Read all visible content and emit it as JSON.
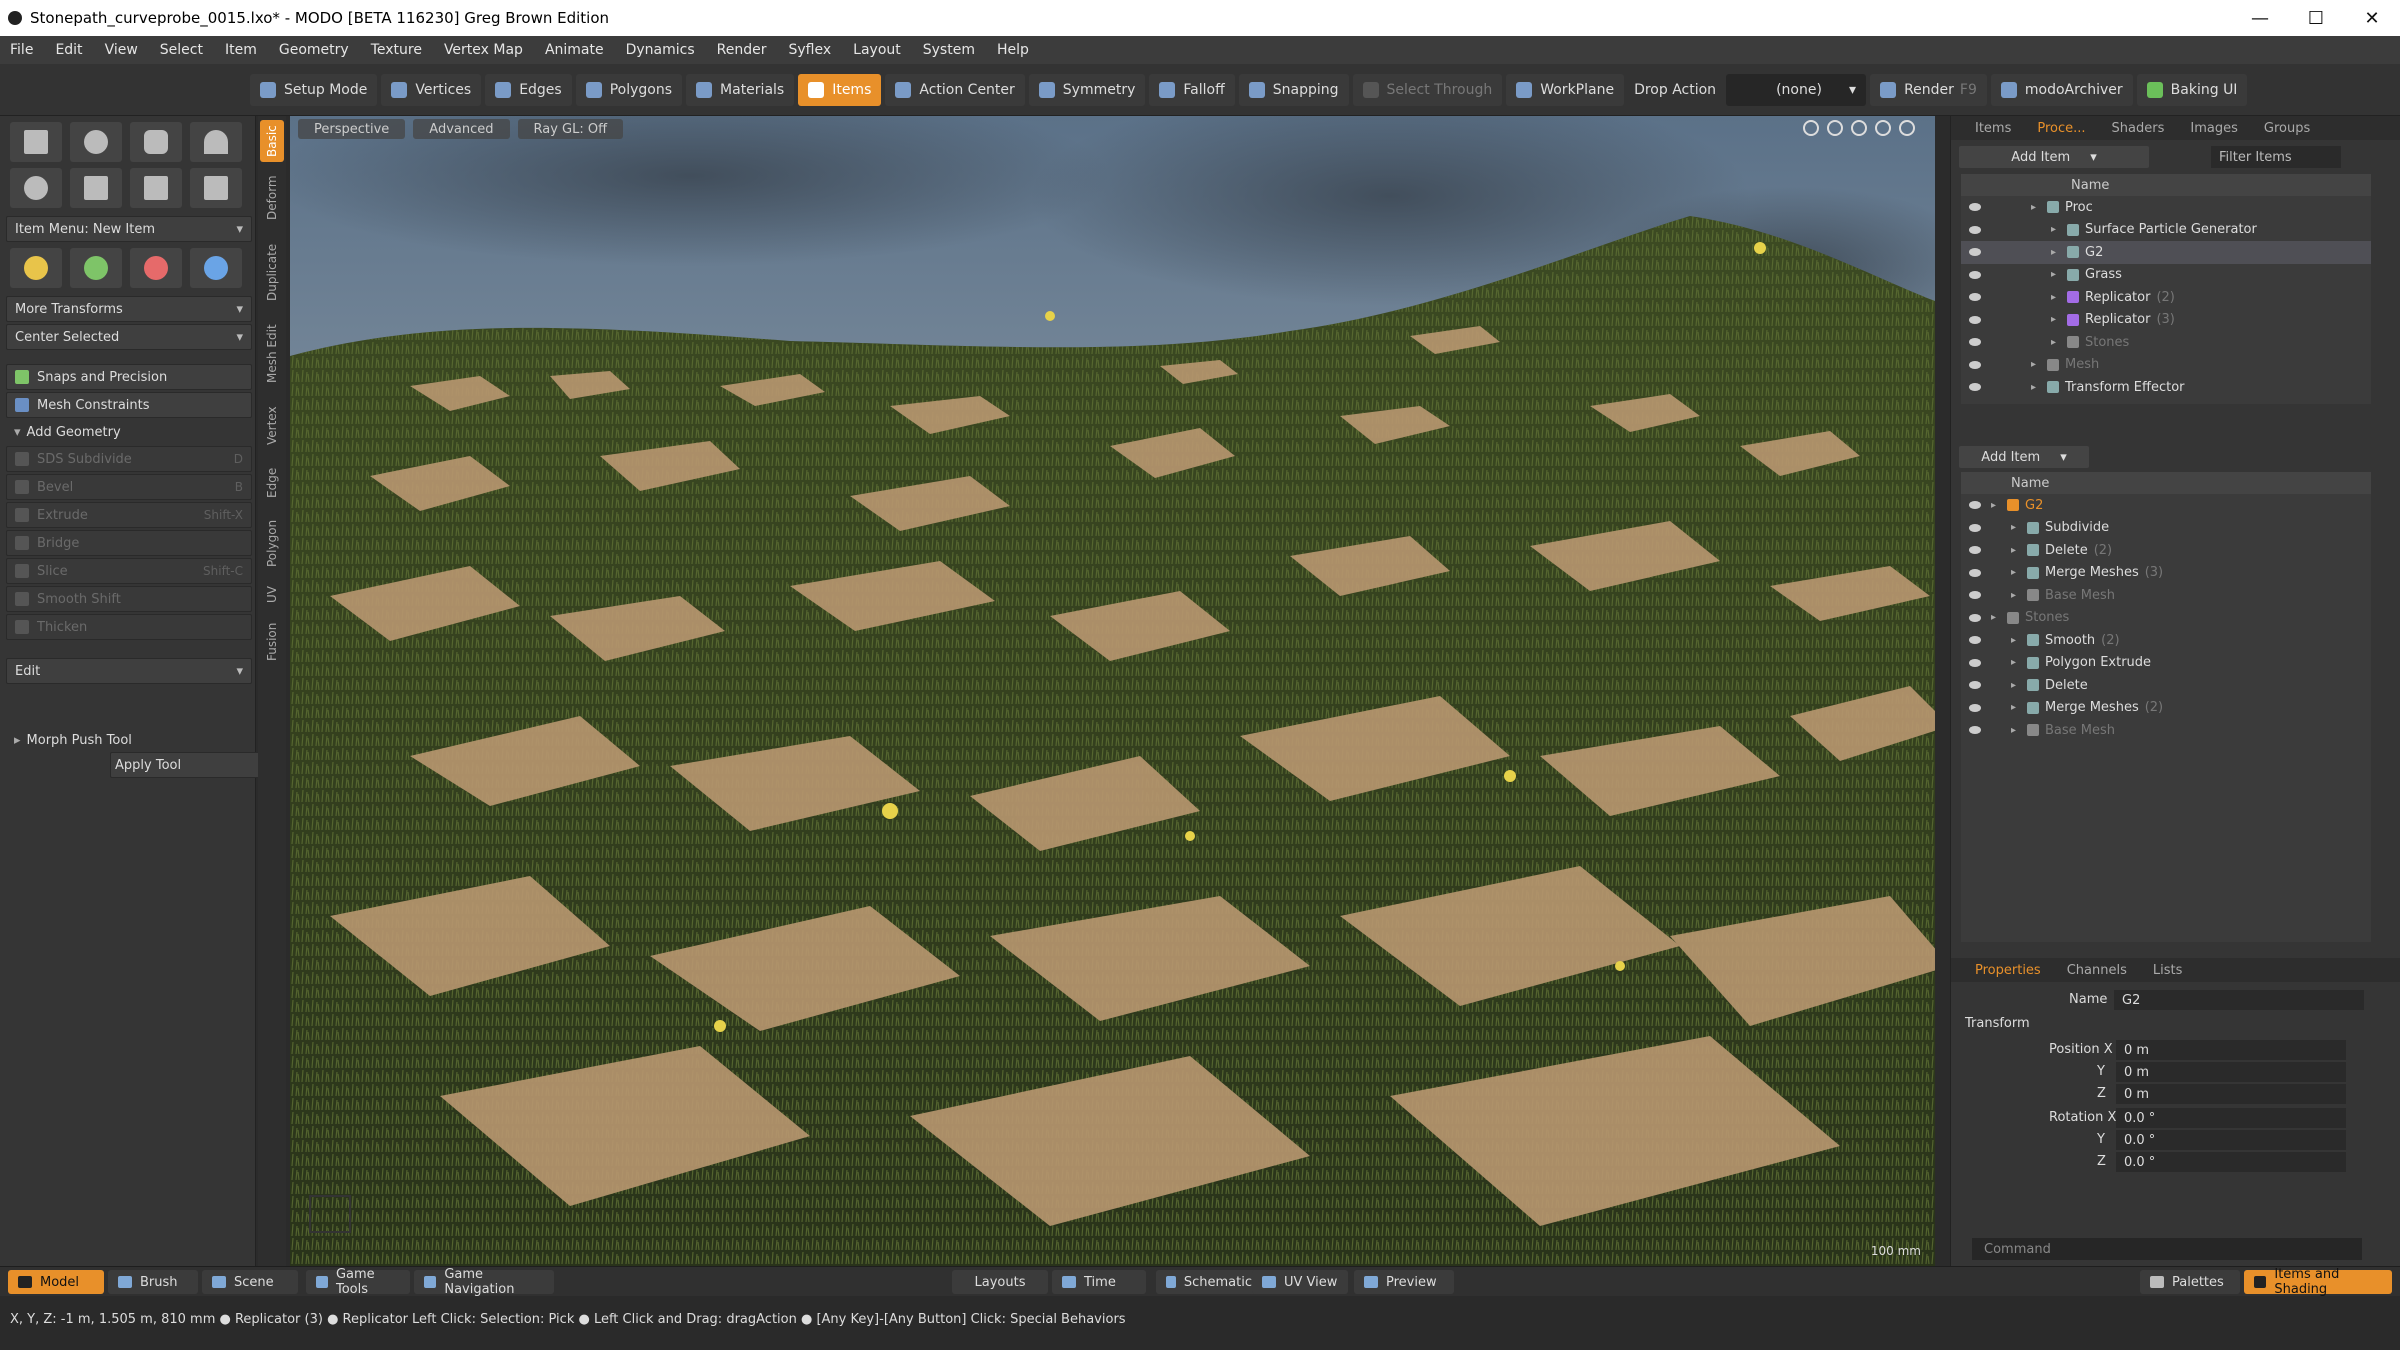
{
  "window": {
    "title": "Stonepath_curveprobe_0015.lxo* - MODO [BETA 116230] Greg Brown Edition",
    "controls": {
      "minimize": "—",
      "maximize": "☐",
      "close": "✕"
    }
  },
  "menu": [
    "File",
    "Edit",
    "View",
    "Select",
    "Item",
    "Geometry",
    "Texture",
    "Vertex Map",
    "Animate",
    "Dynamics",
    "Render",
    "Syflex",
    "Layout",
    "System",
    "Help"
  ],
  "toolbar": {
    "setup_mode": "Setup Mode",
    "vertices": "Vertices",
    "edges": "Edges",
    "polygons": "Polygons",
    "materials": "Materials",
    "items": "Items",
    "action_center": "Action Center",
    "symmetry": "Symmetry",
    "falloff": "Falloff",
    "snapping": "Snapping",
    "select_through": "Select Through",
    "workplane": "WorkPlane",
    "drop_action_label": "Drop Action",
    "drop_action_value": "(none)",
    "render": "Render",
    "render_key": "F9",
    "modoarchiver": "modoArchiver",
    "baking_ui": "Baking UI"
  },
  "left_panel": {
    "item_menu": "Item Menu: New Item",
    "more_transforms": "More Transforms",
    "center_selected": "Center Selected",
    "snaps_precision": "Snaps and Precision",
    "mesh_constraints": "Mesh Constraints",
    "add_geometry": "Add Geometry",
    "tools": [
      {
        "label": "SDS Subdivide",
        "shortcut": "D"
      },
      {
        "label": "Bevel",
        "shortcut": "B"
      },
      {
        "label": "Extrude",
        "shortcut": "Shift-X"
      },
      {
        "label": "Bridge",
        "shortcut": ""
      },
      {
        "label": "Slice",
        "shortcut": "Shift-C"
      },
      {
        "label": "Smooth Shift",
        "shortcut": ""
      },
      {
        "label": "Thicken",
        "shortcut": ""
      }
    ],
    "edit": "Edit",
    "morph_push_tool": "Morph Push Tool",
    "apply_tool": "Apply Tool",
    "vertical_tabs": [
      "Basic",
      "Deform",
      "Duplicate",
      "Mesh Edit",
      "Vertex",
      "Edge",
      "Polygon",
      "UV",
      "Fusion"
    ]
  },
  "viewport": {
    "tabs": [
      "Perspective",
      "Advanced",
      "Ray GL: Off"
    ],
    "info": "100 mm"
  },
  "right_panel": {
    "top_tabs": [
      "Items",
      "Proce...",
      "Shaders",
      "Images",
      "Groups"
    ],
    "add_item": "Add Item",
    "filter_items": "Filter Items",
    "name_header": "Name",
    "tree_top": [
      {
        "label": "Proc",
        "indent": 1,
        "type": "folder"
      },
      {
        "label": "Surface Particle Generator",
        "indent": 2,
        "type": "gen"
      },
      {
        "label": "G2",
        "indent": 2,
        "type": "mesh",
        "selected": true
      },
      {
        "label": "Grass",
        "indent": 2,
        "type": "mesh"
      },
      {
        "label": "Replicator",
        "count": "(2)",
        "indent": 2,
        "type": "rep"
      },
      {
        "label": "Replicator",
        "count": "(3)",
        "indent": 2,
        "type": "rep"
      },
      {
        "label": "Stones",
        "indent": 2,
        "type": "mesh",
        "dim": true
      },
      {
        "label": "Mesh",
        "indent": 1,
        "type": "mesh",
        "dim": true
      },
      {
        "label": "Transform Effector",
        "indent": 1,
        "type": "eff"
      }
    ],
    "add_item2": "Add Item",
    "tree_bottom": [
      {
        "label": "G2",
        "indent": 1,
        "dim": false,
        "orange": true
      },
      {
        "label": "Subdivide",
        "indent": 2
      },
      {
        "label": "Delete",
        "count": "(2)",
        "indent": 2
      },
      {
        "label": "Merge Meshes",
        "count": "(3)",
        "indent": 2
      },
      {
        "label": "Base Mesh",
        "indent": 2,
        "dim": true
      },
      {
        "label": "Stones",
        "indent": 1,
        "dim": true
      },
      {
        "label": "Smooth",
        "count": "(2)",
        "indent": 2
      },
      {
        "label": "Polygon Extrude",
        "indent": 2
      },
      {
        "label": "Delete",
        "indent": 2
      },
      {
        "label": "Merge Meshes",
        "count": "(2)",
        "indent": 2
      },
      {
        "label": "Base Mesh",
        "indent": 2,
        "dim": true
      }
    ],
    "prop_tabs": [
      "Properties",
      "Channels",
      "Lists"
    ],
    "name_label": "Name",
    "name_value": "G2",
    "transform": "Transform",
    "position_label": "Position X",
    "rotation_label": "Rotation X",
    "y": "Y",
    "z": "Z",
    "pos": [
      "0 m",
      "0 m",
      "0 m"
    ],
    "rot": [
      "0.0 °",
      "0.0 °",
      "0.0 °"
    ],
    "command_placeholder": "Command"
  },
  "bottom_bar": {
    "left": [
      "Model",
      "Brush",
      "Scene",
      "Game Tools",
      "Game Navigation"
    ],
    "center": [
      "Layouts",
      "Time",
      "Schematic",
      "UV View",
      "Preview"
    ],
    "right": [
      "Palettes",
      "Items and Shading"
    ]
  },
  "status": {
    "coords": "X, Y, Z:  -1 m, 1.505 m, 810 mm ● Replicator (3) ● Replicator",
    "hints": "Left Click: Selection: Pick ● Left Click and Drag: dragAction ● [Any Key]-[Any Button] Click: Special Behaviors"
  }
}
